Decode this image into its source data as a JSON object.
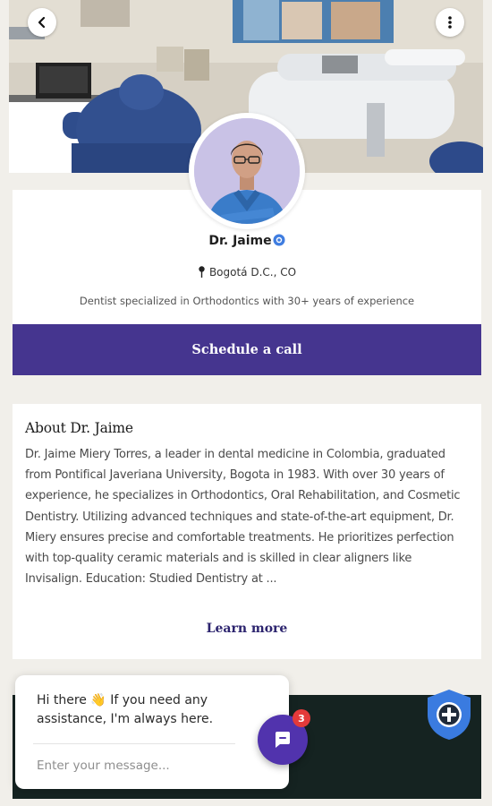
{
  "header": {
    "back_icon": "chevron-left-icon",
    "menu_icon": "more-vertical-icon"
  },
  "profile": {
    "name": "Dr. Jaime",
    "verified_icon": "verified-badge-icon",
    "location_icon": "map-pin-icon",
    "location": "Bogotá D.C., CO",
    "tagline": "Dentist specialized in Orthodontics with 30+ years of experience"
  },
  "actions": {
    "schedule_label": "Schedule a call"
  },
  "about": {
    "title": "About Dr. Jaime",
    "body": "Dr. Jaime Miery Torres, a leader in dental medicine in Colombia, graduated from Pontifical Javeriana University, Bogota in 1983. With over 30 years of experience, he specializes in Orthodontics, Oral Rehabilitation, and Cosmetic Dentistry. Utilizing advanced techniques and state-of-the-art equipment, Dr. Miery ensures precise and comfortable treatments. He prioritizes perfection with top-quality ceramic materials and is skilled in clear aligners like Invisalign. Education: Studied Dentistry at ...",
    "learn_more_label": "Learn more"
  },
  "chat": {
    "greeting": "Hi there 👋 If you need any assistance, I'm always here.",
    "input_placeholder": "Enter your message...",
    "unread_count": "3",
    "launcher_icon": "chat-bubble-icon"
  },
  "colors": {
    "primary": "#45358f",
    "link": "#2c246e",
    "dark_block": "#152321",
    "badge": "#3f7de0",
    "notification": "#e33a3a"
  }
}
